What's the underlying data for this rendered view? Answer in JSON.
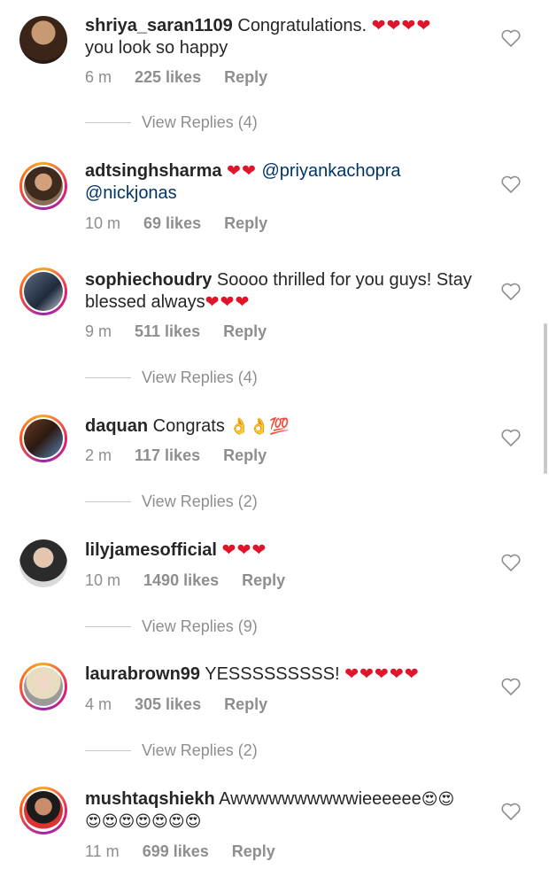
{
  "comments": [
    {
      "user": "shriya_saran1109",
      "text": " Congratulations. ",
      "hearts": "❤❤❤❤",
      "text2": "you look so happy",
      "time": "6 m",
      "likes": "225 likes",
      "reply": "Reply",
      "view_replies": "View Replies (4)"
    },
    {
      "user": "adtsinghsharma",
      "hearts": "❤❤",
      "mention1": "@priyankachopra",
      "mention2": "@nickjonas",
      "time": "10 m",
      "likes": "69 likes",
      "reply": "Reply"
    },
    {
      "user": "sophiechoudry",
      "text": " Soooo thrilled for you guys! Stay blessed always",
      "hearts": "❤❤❤",
      "time": "9 m",
      "likes": "511 likes",
      "reply": "Reply",
      "view_replies": "View Replies (4)"
    },
    {
      "user": "daquan",
      "text": " Congrats ",
      "emojis": "👌👌💯",
      "time": "2 m",
      "likes": "117 likes",
      "reply": "Reply",
      "view_replies": "View Replies (2)"
    },
    {
      "user": "lilyjamesofficial",
      "hearts": "❤❤❤",
      "time": "10 m",
      "likes": "1490 likes",
      "reply": "Reply",
      "view_replies": "View Replies (9)"
    },
    {
      "user": "laurabrown99",
      "text": " YESSSSSSSSS! ",
      "hearts": "❤❤❤❤❤",
      "time": "4 m",
      "likes": "305 likes",
      "reply": "Reply",
      "view_replies": "View Replies (2)"
    },
    {
      "user": "mushtaqshiekh",
      "text": " Awwwwwwwwwwieeeeee",
      "emojis": "😍😍",
      "emojis2": "😍😍😍😍😍😍😍",
      "time": "11 m",
      "likes": "699 likes",
      "reply": "Reply"
    }
  ],
  "icons": {
    "like": "heart-outline-icon"
  },
  "colors": {
    "heart": "#e0142a",
    "meta": "#8e8e8e",
    "mention": "#003569"
  }
}
